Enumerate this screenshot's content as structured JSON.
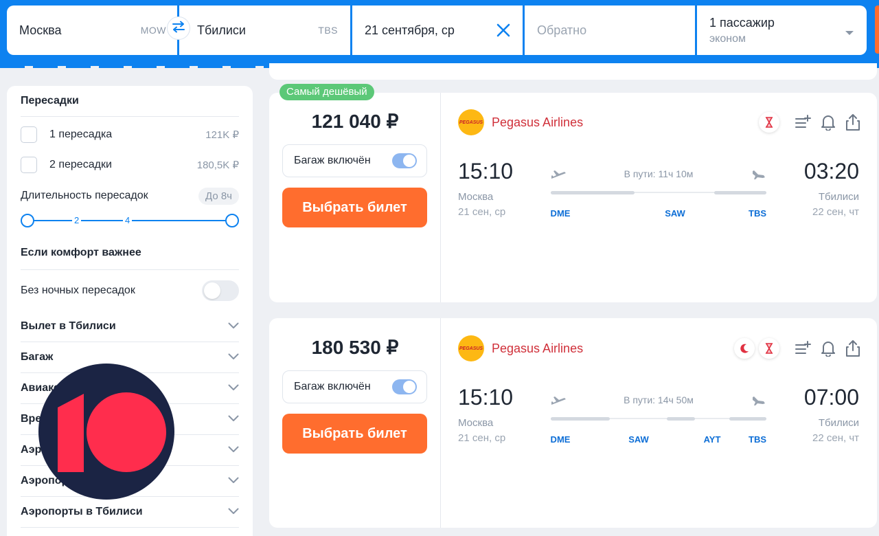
{
  "search": {
    "from_city": "Москва",
    "from_code": "MOW",
    "to_city": "Тбилиси",
    "to_code": "TBS",
    "date": "21 сентября, ср",
    "return_placeholder": "Обратно",
    "passengers": "1 пассажир",
    "class": "эконом"
  },
  "filters": {
    "transfers_title": "Пересадки",
    "transfer_options": [
      {
        "label": "1 пересадка",
        "price": "121K ₽"
      },
      {
        "label": "2 пересадки",
        "price": "180,5K ₽"
      }
    ],
    "duration_label": "Длительность пересадок",
    "duration_value": "До 8ч",
    "slider_ticks": [
      "2",
      "4"
    ],
    "comfort_title": "Если комфорт важнее",
    "no_night_label": "Без ночных пересадок",
    "accordions": [
      "Вылет в Тбилиси",
      "Багаж",
      "Авиакомпании",
      "Время в пути",
      "Аэропорты пересадки",
      "Аэропорты в Москве",
      "Аэропорты в Тбилиси"
    ]
  },
  "tickets": [
    {
      "badge": "Самый дешёвый",
      "price": "121 040 ₽",
      "baggage_label": "Багаж включён",
      "buy_label": "Выбрать билет",
      "airline": "Pegasus Airlines",
      "logo_text": "PEGASUS",
      "depart_time": "15:10",
      "depart_city": "Москва",
      "depart_date": "21 сен, ср",
      "arrive_time": "03:20",
      "arrive_city": "Тбилиси",
      "arrive_date": "22 сен, чт",
      "duration": "В пути: 11ч 10м",
      "airports": [
        "DME",
        "SAW",
        "TBS"
      ]
    },
    {
      "price": "180 530 ₽",
      "baggage_label": "Багаж включён",
      "buy_label": "Выбрать билет",
      "airline": "Pegasus Airlines",
      "logo_text": "PEGASUS",
      "depart_time": "15:10",
      "depart_city": "Москва",
      "depart_date": "21 сен, ср",
      "arrive_time": "07:00",
      "arrive_city": "Тбилиси",
      "arrive_date": "22 сен, чт",
      "duration": "В пути: 14ч 50м",
      "airports": [
        "DME",
        "SAW",
        "AYT",
        "TBS"
      ]
    }
  ],
  "colors": {
    "brand_blue": "#0d82f0",
    "buy_orange": "#ff6d2e",
    "cheap_green": "#5cc878",
    "airline_red": "#d0303a",
    "watermark_navy": "#1b2444",
    "watermark_red": "#ff2d4d"
  }
}
